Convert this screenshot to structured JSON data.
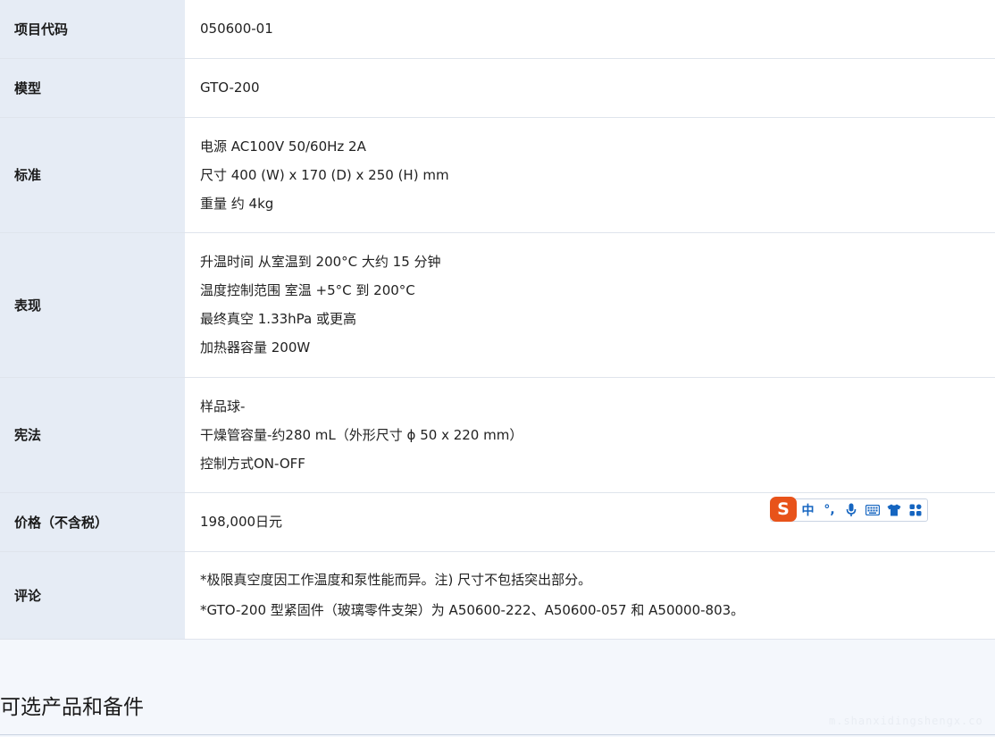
{
  "spec_rows": [
    {
      "label": "项目代码",
      "lines": [
        "050600-01"
      ]
    },
    {
      "label": "模型",
      "lines": [
        "GTO-200"
      ]
    },
    {
      "label": "标准",
      "lines": [
        "电源 AC100V 50/60Hz 2A",
        "尺寸 400 (W) x 170 (D) x 250 (H) mm",
        "重量 约 4kg"
      ]
    },
    {
      "label": "表现",
      "lines": [
        "升温时间 从室温到 200°C 大约 15 分钟",
        "温度控制范围 室温 +5°C 到 200°C",
        "最终真空 1.33hPa 或更高",
        "加热器容量 200W"
      ]
    },
    {
      "label": "宪法",
      "lines": [
        "样品球-",
        "干燥管容量-约280 mL（外形尺寸 ϕ 50 x 220 mm）",
        "控制方式ON-OFF"
      ]
    },
    {
      "label": "价格（不含税）",
      "lines": [
        "198,000日元"
      ]
    },
    {
      "label": "评论",
      "lines": [
        "*极限真空度因工作温度和泵性能而异。注) 尺寸不包括突出部分。",
        "*GTO-200 型紧固件（玻璃零件支架）为 A50600-222、A50600-057 和 A50000-803。"
      ]
    }
  ],
  "section": {
    "title": "可选产品和备件"
  },
  "ime_toolbar": {
    "logo": "S",
    "mode_label": "中",
    "punct_label": "°,",
    "icons": [
      "microphone-icon",
      "keyboard-icon",
      "shirt-icon",
      "apps-grid-icon"
    ],
    "accent": "#1565c0",
    "logo_color": "#e8531a"
  },
  "watermark": {
    "text": "m.shanxidingshengx.co"
  }
}
